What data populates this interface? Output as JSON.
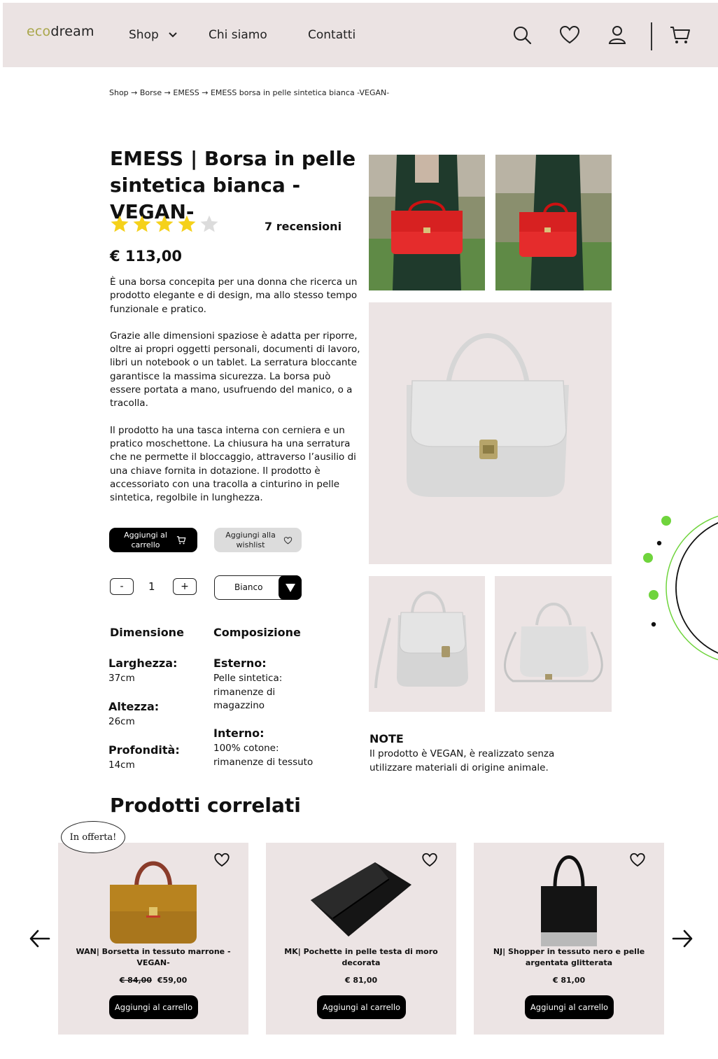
{
  "header": {
    "logo_prefix": "eco",
    "logo_suffix": "dream",
    "nav": {
      "shop": "Shop",
      "about": "Chi siamo",
      "contact": "Contatti"
    },
    "icons": [
      "search-icon",
      "heart-icon",
      "user-icon",
      "cart-icon"
    ]
  },
  "breadcrumb": "Shop → Borse → EMESS → EMESS borsa in pelle sintetica bianca -VEGAN-",
  "product": {
    "title": "EMESS | Borsa in pelle sintetica bianca - VEGAN-",
    "rating": 4,
    "rating_max": 5,
    "reviews": "7 recensioni",
    "price": "€ 113,00",
    "description": [
      "È una borsa concepita per una donna che ricerca un prodotto elegante e di design, ma allo stesso tempo funzionale e pratico.",
      "Grazie alle dimensioni spaziose è adatta per riporre, oltre ai propri oggetti personali, documenti di lavoro, libri un notebook o un tablet. La serratura bloccante garantisce la massima sicurezza. La borsa può essere portata a mano, usufruendo del manico, o a tracolla.",
      "Il prodotto ha una tasca interna con cerniera e un pratico moschettone. La chiusura ha una serratura che ne permette il bloccaggio, attraverso l’ausilio di una chiave fornita in dotazione. Il prodotto è accessoriato con una tracolla a cinturino in pelle sintetica, regolbile in lunghezza."
    ],
    "add_to_cart": "Aggiungi al carrello",
    "add_to_wishlist": "Aggiungi alla wishlist",
    "qty_minus": "-",
    "qty_value": "1",
    "qty_plus": "+",
    "color_selected": "Bianco"
  },
  "specs": {
    "dimension_heading": "Dimensione",
    "composition_heading": "Composizione",
    "width_label": "Larghezza:",
    "width_value": "37cm",
    "height_label": "Altezza:",
    "height_value": "26cm",
    "depth_label": "Profondità:",
    "depth_value": "14cm",
    "outer_label": "Esterno:",
    "outer_value": "Pelle sintetica: rimanenze di magazzino",
    "inner_label": "Interno:",
    "inner_value": "100% cotone: rimanenze di tessuto"
  },
  "note": {
    "heading": "NOTE",
    "text": "Il prodotto è VEGAN, è realizzato senza utilizzare materiali di origine animale."
  },
  "related": {
    "title": "Prodotti correlati",
    "badge": "In offerta!",
    "items": [
      {
        "name": "WAN| Borsetta in tessuto marrone -VEGAN-",
        "old_price": "€ 84,00",
        "price": "€59,00",
        "button": "Aggiungi al carrello"
      },
      {
        "name": "MK| Pochette in pelle testa di moro decorata",
        "price": "€ 81,00",
        "button": "Aggiungi al carrello"
      },
      {
        "name": "NJ| Shopper in tessuto nero e pelle argentata glitterata",
        "price": "€ 81,00",
        "button": "Aggiungi al carrello"
      }
    ]
  },
  "colors": {
    "header_bg": "#ebe3e3",
    "card_bg": "#ece4e4",
    "logo_accent": "#a9a64a",
    "star": "#f5d11b",
    "deco_green": "#6fd43c"
  }
}
